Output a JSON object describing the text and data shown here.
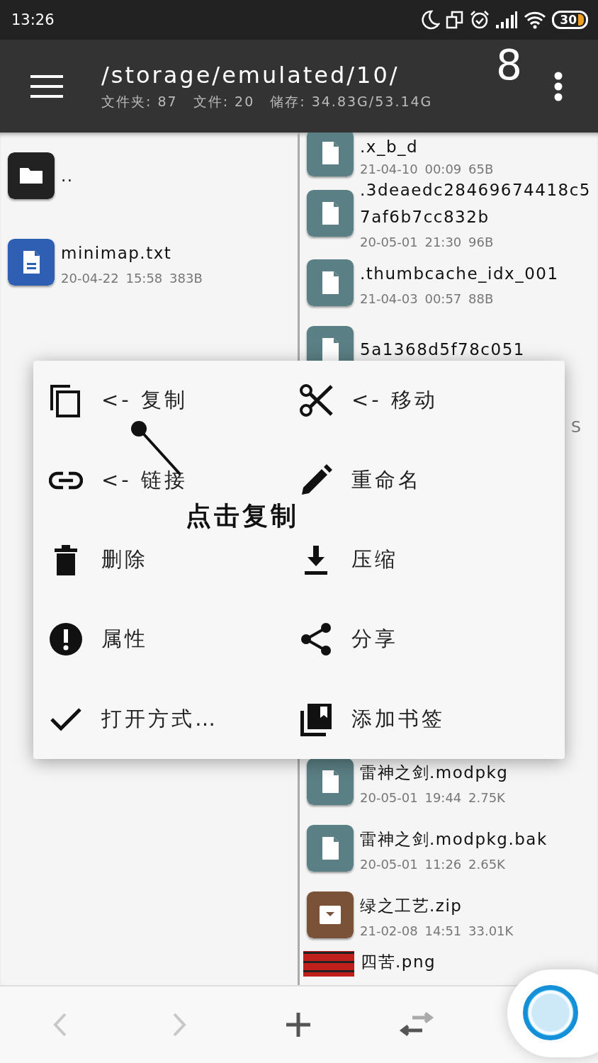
{
  "status_bar": {
    "time": "13:26",
    "battery": "30"
  },
  "app_bar": {
    "path": "/storage/emulated/10/",
    "stats": [
      "文件夹: 87",
      "文件: 20",
      "储存: 34.83G/53.14G"
    ],
    "overlay_number": "8"
  },
  "left_pane": {
    "files": [
      {
        "kind": "folder",
        "name": ".."
      },
      {
        "kind": "text",
        "name": "minimap.txt",
        "meta": "20-04-22 15:58 383B"
      }
    ]
  },
  "right_pane": {
    "files": [
      {
        "kind": "generic",
        "name": ".x_b_d",
        "meta": "21-04-10 00:09 65B"
      },
      {
        "kind": "generic",
        "name": ".3deaedc28469674418c57af6b7cc832b",
        "meta": "20-05-01 21:30 96B"
      },
      {
        "kind": "generic",
        "name": ".thumbcache_idx_001",
        "meta": "21-04-03 00:57 88B"
      },
      {
        "kind": "generic",
        "name": "5a1368d5f78c051"
      },
      {
        "kind": "fragment",
        "name": "S"
      },
      {
        "kind": "generic",
        "name": "雷神之剑.modpkg",
        "meta": "20-05-01 19:44 2.75K"
      },
      {
        "kind": "generic",
        "name": "雷神之剑.modpkg.bak",
        "meta": "20-05-01 11:26 2.65K"
      },
      {
        "kind": "archive",
        "name": "绿之工艺.zip",
        "meta": "21-02-08 14:51 33.01K"
      },
      {
        "kind": "image",
        "name": "四苦.png"
      }
    ]
  },
  "context_menu": {
    "items": [
      {
        "label": "<- 复制"
      },
      {
        "label": "<- 移动"
      },
      {
        "label": "<- 链接"
      },
      {
        "label": "重命名"
      },
      {
        "label": "删除"
      },
      {
        "label": "压缩"
      },
      {
        "label": "属性"
      },
      {
        "label": "分享"
      },
      {
        "label": "打开方式…"
      },
      {
        "label": "添加书签"
      }
    ]
  },
  "annotation": {
    "text": "点击复制"
  },
  "bottom_bar": {
    "buttons": [
      {
        "disabled": true
      },
      {
        "disabled": true
      },
      {
        "disabled": false
      },
      {
        "disabled": false
      }
    ]
  }
}
